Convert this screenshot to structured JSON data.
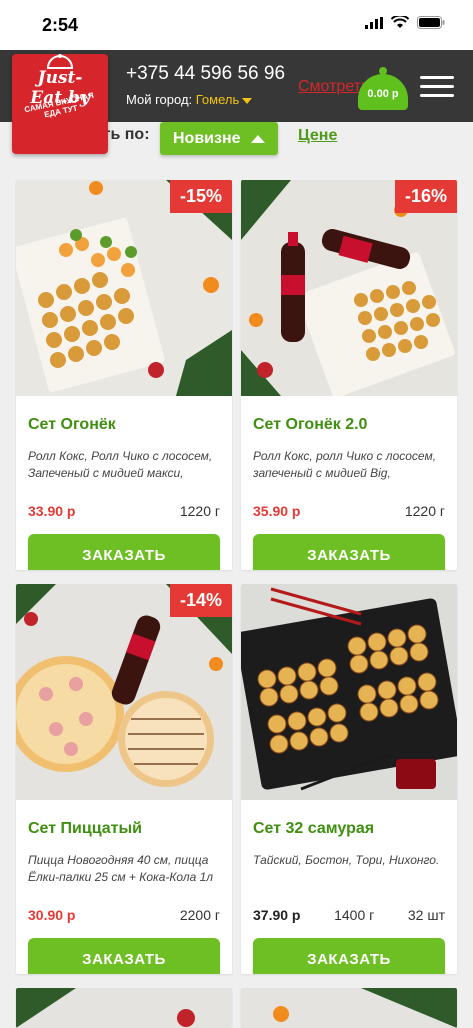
{
  "status": {
    "time": "2:54"
  },
  "header": {
    "logo_text": "Just-Eat.by",
    "logo_tagline": "САМАЯ ВКУСНАЯ ЕДА ТУТ",
    "phone": "+375 44 596 56 96",
    "city_label": "Мой город:",
    "city": "Гомель",
    "view_link": "Смотреть все",
    "cart_value": "0.00 р"
  },
  "sort": {
    "label": "Сортировать по:",
    "active": "Новизне",
    "option": "Цене"
  },
  "products": [
    {
      "title": "Сет Огонёк",
      "desc": "Ролл Кокс, Ролл Чико с лососем, Запеченый с мидией макси,",
      "price": "33.90 р",
      "weight": "1220 г",
      "discount": "-15%",
      "button": "ЗАКАЗАТЬ",
      "image": "sushi-set-image"
    },
    {
      "title": "Сет Огонёк 2.0",
      "desc": "Ролл Кокс, ролл Чико с лососем, запеченый с мидией Big,",
      "price": "35.90 р",
      "weight": "1220 г",
      "discount": "-16%",
      "button": "ЗАКАЗАТЬ",
      "image": "sushi-cola-image"
    },
    {
      "title": "Сет Пиццатый",
      "desc": "Пицца Новогодняя 40 см, пицца Ёлки-палки 25 см + Кока-Кола 1л",
      "price": "30.90 р",
      "weight": "2200 г",
      "discount": "-14%",
      "button": "ЗАКАЗАТЬ",
      "image": "pizza-set-image"
    },
    {
      "title": "Сет 32 самурая",
      "desc": "Тайский, Бостон, Тори, Нихонго.",
      "price": "37.90 р",
      "weight": "1400 г",
      "pieces": "32 шт",
      "discount": "",
      "button": "ЗАКАЗАТЬ",
      "image": "rolls-board-image"
    }
  ],
  "colors": {
    "accent": "#6ebf24",
    "brand": "#d7262b",
    "discount": "#e53935",
    "title_green": "#3f8f10"
  }
}
